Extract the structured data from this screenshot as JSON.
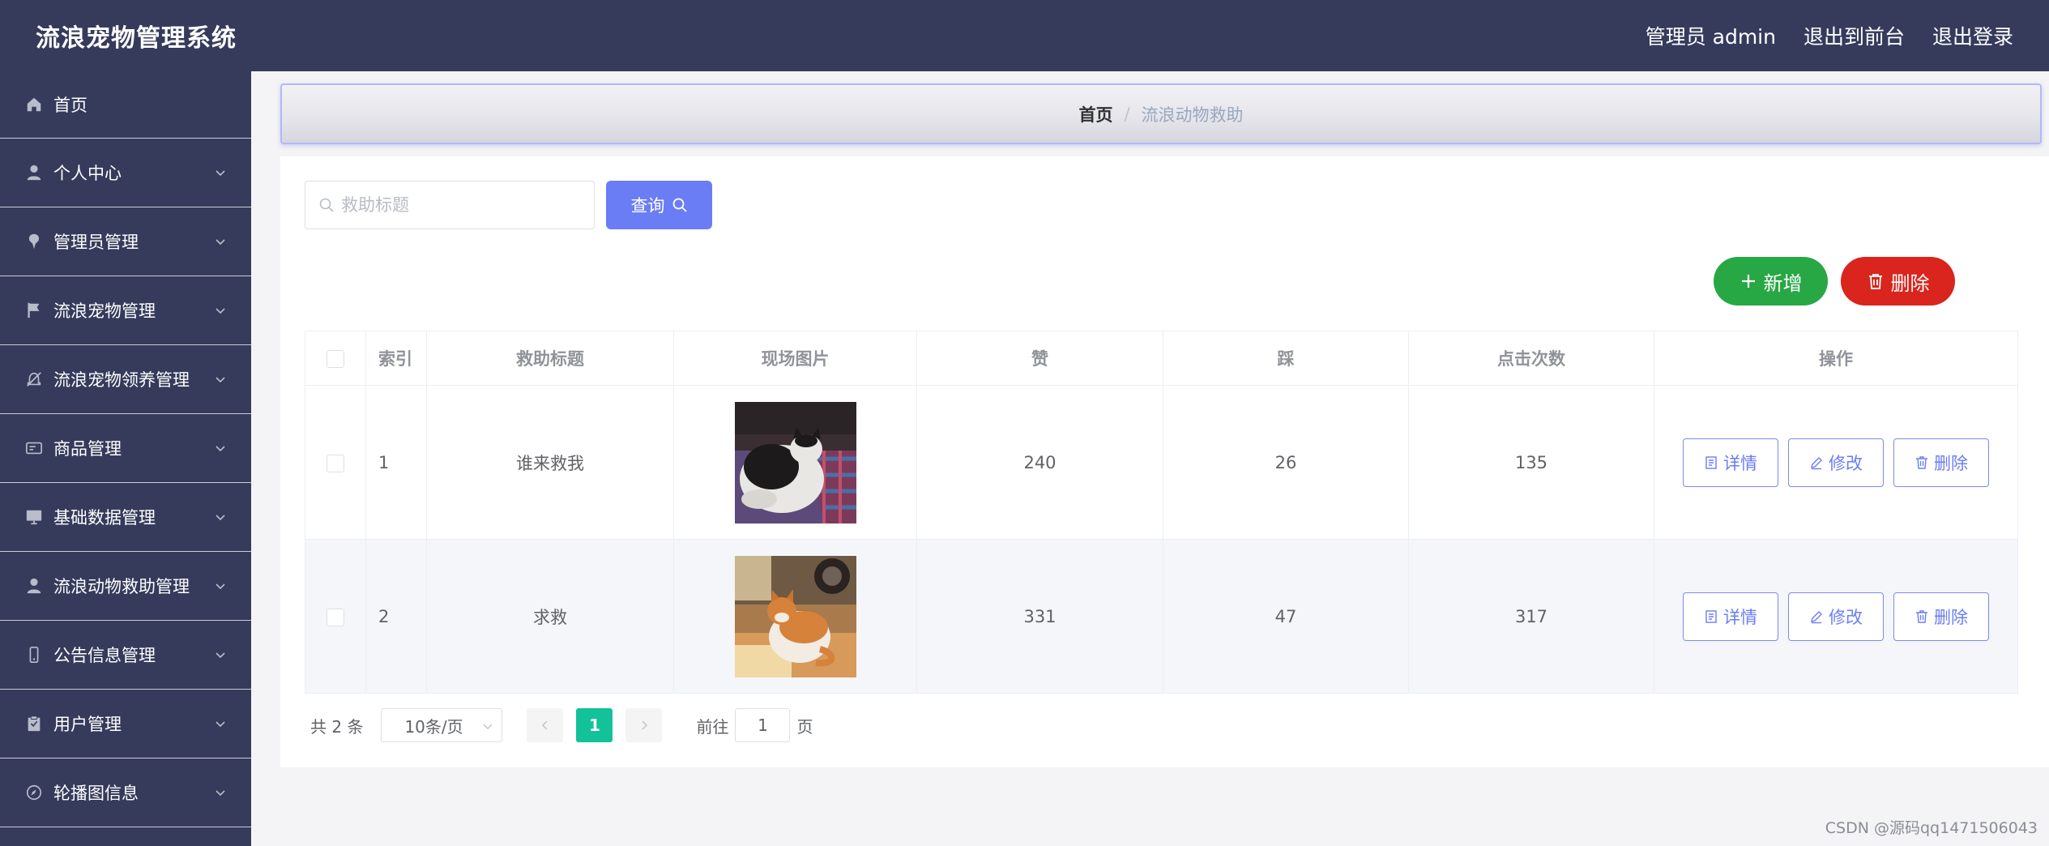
{
  "header": {
    "app_title": "流浪宠物管理系统",
    "user_label": "管理员 admin",
    "to_front_label": "退出到前台",
    "logout_label": "退出登录"
  },
  "sidebar": {
    "items": [
      {
        "label": "首页",
        "icon": "home-icon"
      },
      {
        "label": "个人中心",
        "icon": "user-icon"
      },
      {
        "label": "管理员管理",
        "icon": "pin-icon"
      },
      {
        "label": "流浪宠物管理",
        "icon": "flag-icon"
      },
      {
        "label": "流浪宠物领养管理",
        "icon": "bell-off-icon"
      },
      {
        "label": "商品管理",
        "icon": "card-icon"
      },
      {
        "label": "基础数据管理",
        "icon": "monitor-icon"
      },
      {
        "label": "流浪动物救助管理",
        "icon": "user-icon"
      },
      {
        "label": "公告信息管理",
        "icon": "phone-icon"
      },
      {
        "label": "用户管理",
        "icon": "clipboard-icon"
      },
      {
        "label": "轮播图信息",
        "icon": "compass-icon"
      }
    ]
  },
  "breadcrumb": {
    "home": "首页",
    "separator": "/",
    "current": "流浪动物救助"
  },
  "search": {
    "placeholder": "救助标题",
    "value": "",
    "query_label": "查询"
  },
  "actions": {
    "add_label": "新增",
    "delete_label": "删除"
  },
  "table": {
    "columns": [
      "索引",
      "救助标题",
      "现场图片",
      "赞",
      "踩",
      "点击次数",
      "操作"
    ],
    "rows": [
      {
        "index": "1",
        "title": "谁来救我",
        "image": "cat-photo-black-white",
        "likes": "240",
        "dislikes": "26",
        "clicks": "135"
      },
      {
        "index": "2",
        "title": "求救",
        "image": "cat-photo-orange-white",
        "likes": "331",
        "dislikes": "47",
        "clicks": "317"
      }
    ],
    "row_actions": {
      "detail": "详情",
      "edit": "修改",
      "delete": "删除"
    }
  },
  "pagination": {
    "total_text": "共 2 条",
    "page_size": "10条/页",
    "current_page": "1",
    "goto_label": "前往",
    "goto_value": "1",
    "page_unit": "页"
  },
  "watermark": "CSDN @源码qq1471506043",
  "colors": {
    "header_bg": "#363b5c",
    "primary": "#6b7df5",
    "success": "#28a745",
    "danger": "#d9251d",
    "pager_active": "#13c299"
  }
}
